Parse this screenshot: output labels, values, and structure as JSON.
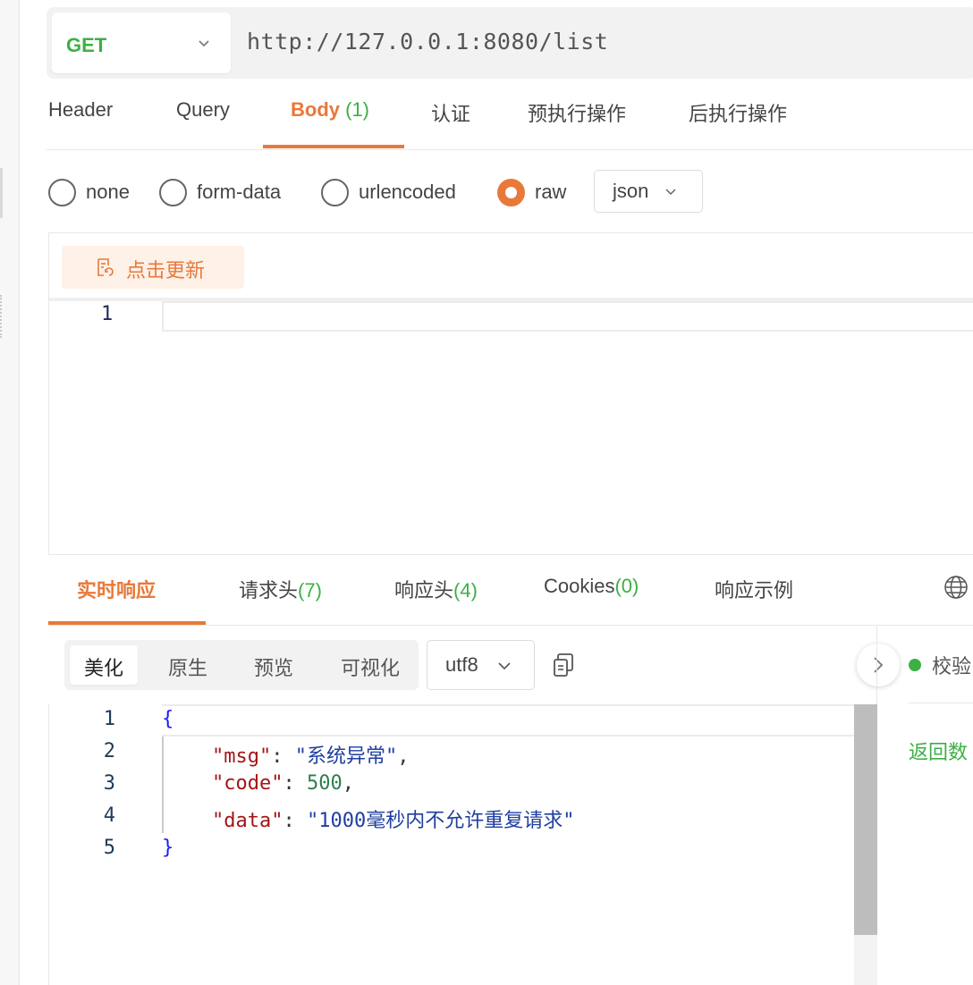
{
  "request": {
    "method": "GET",
    "url": "http://127.0.0.1:8080/list"
  },
  "request_tabs": [
    {
      "label": "Header"
    },
    {
      "label": "Query"
    },
    {
      "label": "Body",
      "count": "(1)",
      "active": true
    },
    {
      "label": "认证"
    },
    {
      "label": "预执行操作"
    },
    {
      "label": "后执行操作"
    }
  ],
  "body_types": [
    {
      "label": "none",
      "checked": false
    },
    {
      "label": "form-data",
      "checked": false
    },
    {
      "label": "urlencoded",
      "checked": false
    },
    {
      "label": "raw",
      "checked": true
    }
  ],
  "body_format": "json",
  "editor": {
    "update_button": "点击更新",
    "line_number": "1"
  },
  "response_tabs": [
    {
      "label": "实时响应",
      "active": true
    },
    {
      "label": "请求头",
      "count": "(7)"
    },
    {
      "label": "响应头",
      "count": "(4)"
    },
    {
      "label": "Cookies",
      "count": "(0)"
    },
    {
      "label": "响应示例"
    }
  ],
  "response_views": [
    {
      "label": "美化",
      "active": true
    },
    {
      "label": "原生"
    },
    {
      "label": "预览"
    },
    {
      "label": "可视化"
    }
  ],
  "encoding": "utf8",
  "side_panel": {
    "validate": "校验",
    "return_data": "返回数"
  },
  "response_body": {
    "line_numbers": [
      "1",
      "2",
      "3",
      "4",
      "5"
    ],
    "open_brace": "{",
    "close_brace": "}",
    "fields": [
      {
        "key": "\"msg\"",
        "value": "\"系统异常\"",
        "value_type": "string",
        "trailing": ","
      },
      {
        "key": "\"code\"",
        "value": "500",
        "value_type": "number",
        "trailing": ","
      },
      {
        "key": "\"data\"",
        "value": "\"1000毫秒内不允许重复请求\"",
        "value_type": "string",
        "trailing": ""
      }
    ]
  },
  "colors": {
    "accent": "#e8793a",
    "success": "#3cb043",
    "json_key": "#a31515",
    "json_string": "#1f3ea0",
    "json_number": "#2e7d4f",
    "json_brace": "#1a1aff"
  }
}
